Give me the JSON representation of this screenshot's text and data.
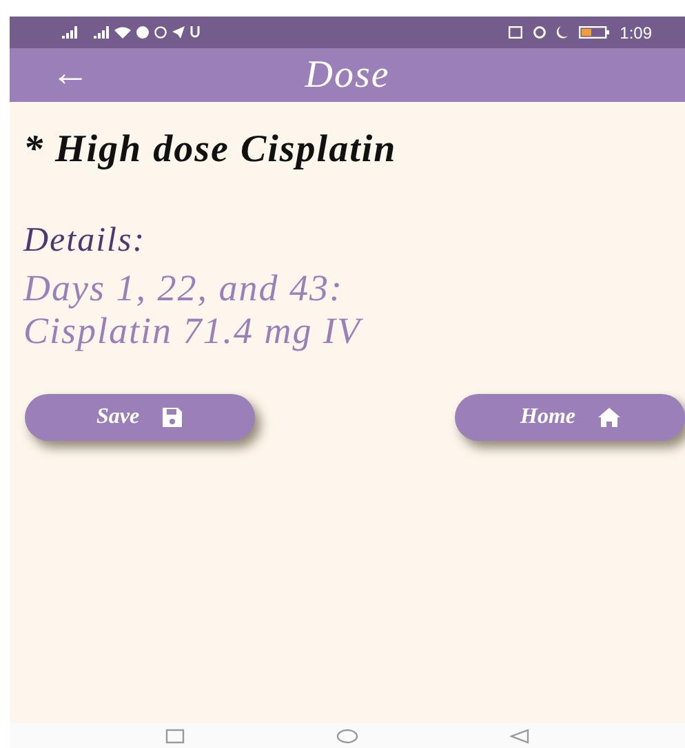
{
  "status_bar": {
    "time": "1:09"
  },
  "app_bar": {
    "title": "Dose",
    "back": "←"
  },
  "heading": "* High dose Cisplatin",
  "details": {
    "label": "Details:",
    "lines": [
      "Days 1, 22, and 43:",
      "Cisplatin 71.4 mg IV"
    ]
  },
  "buttons": [
    {
      "label": "Save",
      "kind": "save"
    },
    {
      "label": "Home",
      "kind": "home"
    }
  ]
}
